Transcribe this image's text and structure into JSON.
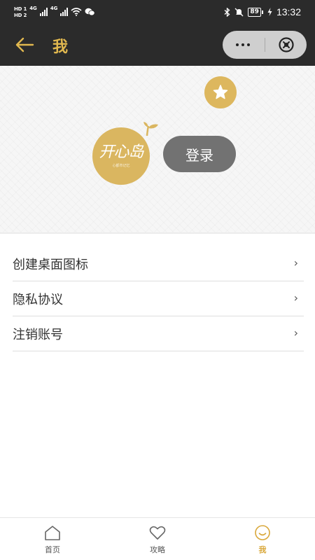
{
  "status_bar": {
    "sim1": "HD 1",
    "sim2": "HD 2",
    "net1": "4G",
    "net2": "4G",
    "battery": "89",
    "time": "13:32"
  },
  "header": {
    "title": "我",
    "back_icon": "arrow-left-icon",
    "more_icon": "more-dots-icon",
    "close_icon": "close-circle-icon"
  },
  "profile": {
    "logo_text": "开心岛",
    "logo_sub": "心都市记忆",
    "login_label": "登录",
    "badge_icon": "star-icon"
  },
  "menu": {
    "items": [
      {
        "label": "创建桌面图标",
        "arrow": "›"
      },
      {
        "label": "隐私协议",
        "arrow": "›"
      },
      {
        "label": "注销账号",
        "arrow": "›"
      }
    ]
  },
  "tabbar": {
    "tabs": [
      {
        "label": "首页",
        "icon": "home-icon"
      },
      {
        "label": "攻略",
        "icon": "heart-icon"
      },
      {
        "label": "我",
        "icon": "smile-icon",
        "active": true
      }
    ]
  },
  "colors": {
    "accent": "#e1b84f",
    "logo": "#dab660",
    "dark_bar": "#2b2b2b",
    "login_button": "#727272",
    "tab_active": "#d9a83b"
  }
}
